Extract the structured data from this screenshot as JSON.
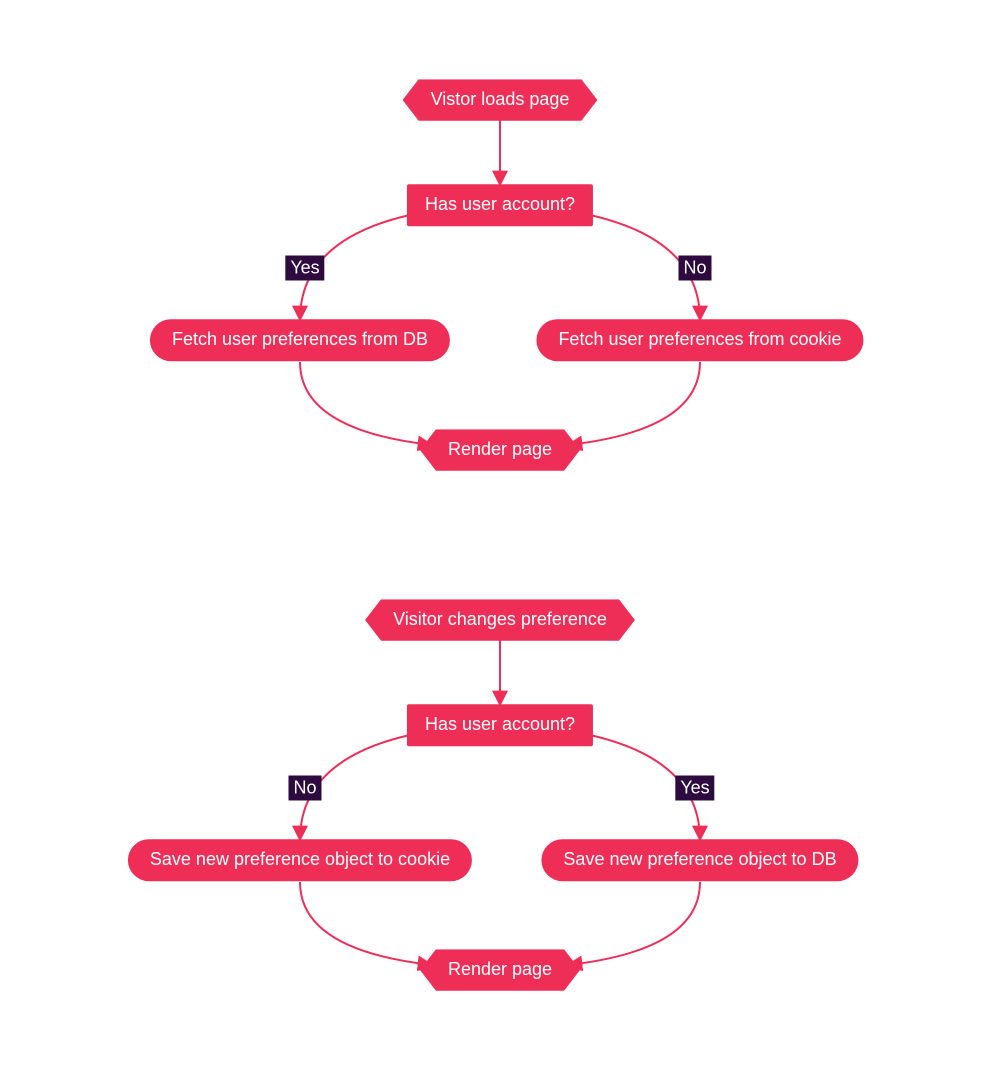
{
  "colors": {
    "node_fill": "#ef2e57",
    "node_text": "#ffffff",
    "edge": "#ef2e57",
    "label_bg": "#2e0b3f",
    "label_text": "#ffffff"
  },
  "flowchart1": {
    "start": {
      "label": "Vistor loads page"
    },
    "decision": {
      "label": "Has user account?"
    },
    "left": {
      "label": "Fetch user preferences from DB"
    },
    "right": {
      "label": "Fetch user preferences from cookie"
    },
    "end": {
      "label": "Render page"
    },
    "edges": {
      "yes": "Yes",
      "no": "No"
    }
  },
  "flowchart2": {
    "start": {
      "label": "Visitor changes preference"
    },
    "decision": {
      "label": "Has user account?"
    },
    "left": {
      "label": "Save new preference object to cookie"
    },
    "right": {
      "label": "Save new preference object to DB"
    },
    "end": {
      "label": "Render page"
    },
    "edges": {
      "left_label": "No",
      "right_label": "Yes"
    }
  }
}
